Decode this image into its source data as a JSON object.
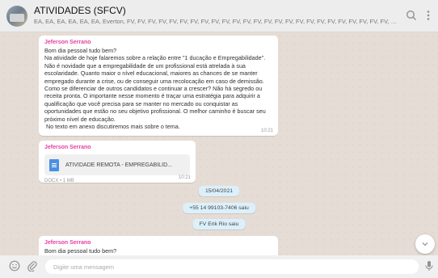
{
  "header": {
    "title": "ATIVIDADES (SFCV)",
    "subtitle": "EA, EA, EA, EA, EA, EA, Everton, FV, FV, FV, FV, FV, FV, FV, FV, FV, FV, FV, FV, FV, FV, FV, FV, FV, FV, FV, FV, FV, FV, FV, FV, FV, FV, FV, FV, FV, FV, FV, FV, FV, FV, FV, FV, FV, FV, FV, FV, ...",
    "search_icon": "search-icon",
    "menu_icon": "menu-icon"
  },
  "messages": {
    "m1": {
      "sender": "Jeferson Serrano",
      "text": "Bom dia pessoal tudo bem?\nNa atividade de hoje falaremos sobre a relação entre \"1 ducação e Empregabilidade\".\nNão é novidade que a empregabilidade de um profissional está atrelada à sua escolaridade. Quanto maior o nível educacional, maiores as chances de se manter empregado durante a crise, ou de conseguir uma recolocação em caso de demissão.\nComo se diferenciar de outros candidatos e continuar a crescer? Não há segredo ou receita pronta. O importante nesse momento é traçar uma estratégia para adquirir a qualificação que você precisa para se manter no mercado ou conquistar as oportunidades que estão no seu objetivo profissional. O melhor caminho é buscar seu próximo nível de educação.\n No texto em anexo discutiremos mais sobre o tema.",
      "time": "10:21"
    },
    "m2": {
      "sender": "Jeferson Serrano",
      "doc_name": "ATIVIDADE REMOTA - EMPREGABILID...",
      "doc_meta": "DOCX • 1 MB",
      "time": "10:21"
    },
    "sys1": "15/04/2021",
    "sys2": "+55 14 99103-7406 saiu",
    "sys3": "FV Erik Rio saiu",
    "m3": {
      "sender": "Jeferson Serrano",
      "text": "Bom dia pessoal tudo bem?\nRealizar atividades como o cultivo de verduras tem uma série de benefícios,"
    }
  },
  "footer": {
    "placeholder": "Digite uma mensagem"
  }
}
